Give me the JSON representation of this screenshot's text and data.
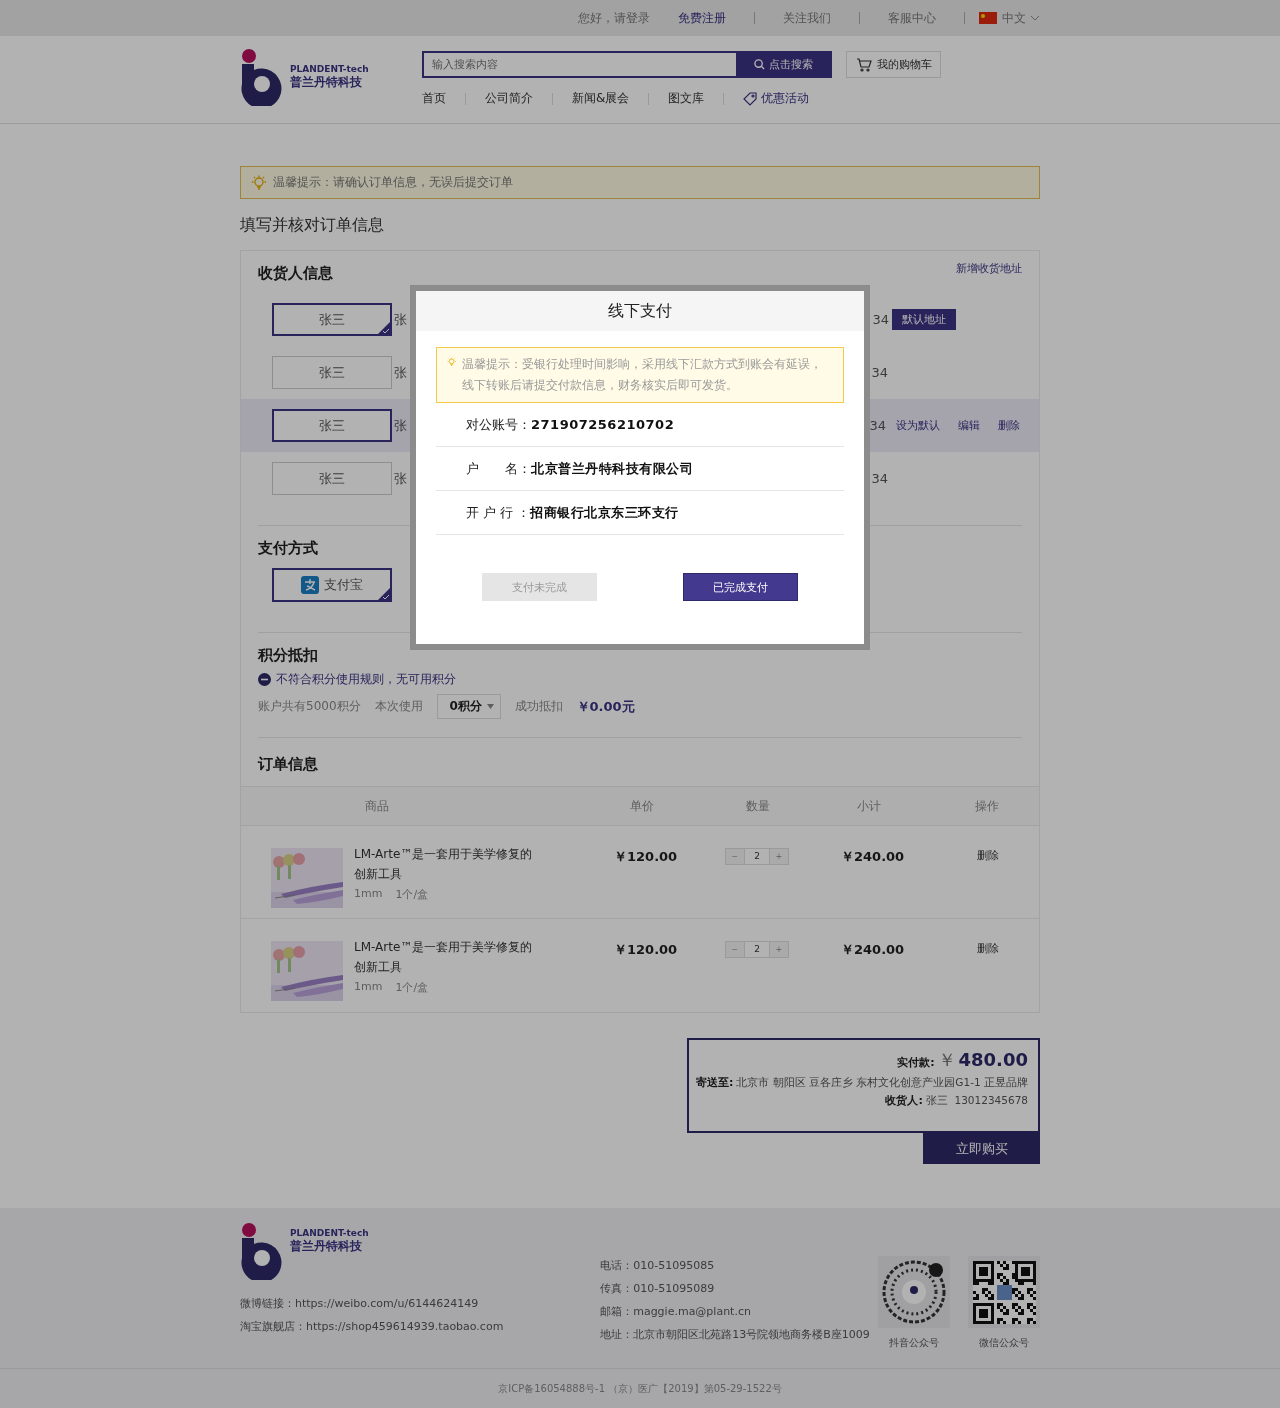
{
  "top_bar": {
    "greeting": "您好，请登录",
    "register": "免费注册",
    "links": [
      "关注我们",
      "客服中心"
    ],
    "language": "中文"
  },
  "header": {
    "logo": {
      "en": "PLANDENT-tech",
      "cn": "普兰丹特科技"
    },
    "search": {
      "placeholder": "输入搜索内容",
      "button": "点击搜索"
    },
    "cart": "我的购物车",
    "nav": [
      {
        "label": "首页",
        "kind": "link"
      },
      {
        "label": "公司简介",
        "kind": "link"
      },
      {
        "label": "新闻&展会",
        "kind": "link"
      },
      {
        "label": "图文库",
        "kind": "link"
      },
      {
        "label": "优惠活动",
        "kind": "promo"
      }
    ]
  },
  "notice": "温馨提示：请确认订单信息，无误后提交订单",
  "page_title": "填写并核对订单信息",
  "consignee": {
    "title": "收货人信息",
    "add_link": "新增收货地址",
    "rows": [
      {
        "name": "张三",
        "selected": true,
        "highlighted": false,
        "detail_start": "张",
        "detail_end": "34",
        "badge": "默认地址"
      },
      {
        "name": "张三",
        "selected": false,
        "highlighted": false,
        "detail_start": "张",
        "detail_end": "34"
      },
      {
        "name": "张三",
        "selected": false,
        "highlighted": true,
        "detail_start": "张",
        "detail_end": "34",
        "actions": [
          "设为默认",
          "编辑",
          "删除"
        ]
      },
      {
        "name": "张三",
        "selected": false,
        "highlighted": false,
        "detail_start": "张",
        "detail_end": "34"
      }
    ]
  },
  "payment": {
    "title": "支付方式",
    "options": [
      {
        "label": "支付宝",
        "selected": true
      }
    ]
  },
  "points": {
    "title": "积分抵扣",
    "warning": "不符合积分使用规则，无可用积分",
    "total": "账户共有5000积分",
    "use_label": "本次使用",
    "select": "0积分",
    "deduct_label": "成功抵扣",
    "deduct_value": "￥0.00元"
  },
  "order": {
    "title": "订单信息",
    "columns": [
      "商品",
      "单价",
      "数量",
      "小计",
      "操作"
    ],
    "rows": [
      {
        "kind": "picture",
        "name": "LM-Arte™是一套用于美学修复的创新工具",
        "spec": "1mm",
        "pack": "1个/盒",
        "price": "￥120.00",
        "qty": "2",
        "minus": "−",
        "plus": "+",
        "subtotal": "￥240.00",
        "action": "删除"
      },
      {
        "kind": "picture",
        "name": "LM-Arte™是一套用于美学修复的创新工具",
        "spec": "1mm",
        "pack": "1个/盒",
        "price": "￥120.00",
        "qty": "2",
        "minus": "−",
        "plus": "+",
        "subtotal": "￥240.00",
        "action": "删除"
      }
    ]
  },
  "summary": {
    "paid_label": "实付款:",
    "currency": "￥",
    "amount": "480.00",
    "ship_label": "寄送至:",
    "address": "北京市 朝阳区 豆各庄乡 东村文化创意产业园G1-1 正昱品牌",
    "receiver_label": "收货人:",
    "receiver": "张三  13012345678",
    "buy": "立即购买"
  },
  "footer": {
    "logo": {
      "en": "PLANDENT-tech",
      "cn": "普兰丹特科技"
    },
    "links": [
      "微博链接：https://weibo.com/u/6144624149",
      "淘宝旗舰店：https://shop459614939.taobao.com"
    ],
    "contacts": [
      "电话：010-51095085",
      "传真：010-51095089",
      "邮箱：maggie.ma@plant.cn",
      "地址：北京市朝阳区北苑路13号院领地商务楼B座1009"
    ],
    "qr": [
      {
        "kind": "douyin",
        "label": "抖音公众号"
      },
      {
        "kind": "wechat",
        "label": "微信公众号"
      }
    ],
    "copyright": "京ICP备16054888号-1 （京）医广【2019】第05-29-1522号"
  },
  "modal": {
    "title": "线下支付",
    "tip": "温馨提示：受银行处理时间影响，采用线下汇款方式到账会有延误，线下转账后请提交付款信息，财务核实后即可发货。",
    "fields": [
      {
        "label": "对公账号：",
        "value": "271907256210702"
      },
      {
        "label": "户　　名：",
        "value": "北京普兰丹特科技有限公司"
      },
      {
        "label": "开 户 行 ：",
        "value": "招商银行北京东三环支行"
      }
    ],
    "buttons": [
      {
        "label": "支付未完成",
        "kind": "secondary"
      },
      {
        "label": "已完成支付",
        "kind": "primary"
      }
    ]
  }
}
